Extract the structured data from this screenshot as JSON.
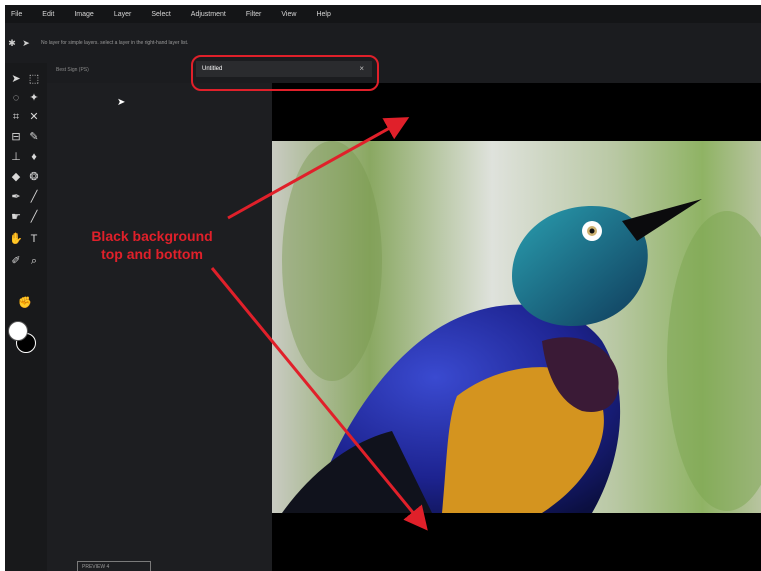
{
  "menu": [
    "File",
    "Edit",
    "Image",
    "Layer",
    "Select",
    "Adjustment",
    "Filter",
    "View",
    "Help"
  ],
  "options_bar": {
    "hint": "No layer for simple layers. select a layer in the right-hand layer list."
  },
  "tabs": {
    "inactive_label": "Best Sign (PS)",
    "active_label": "Untitled",
    "close_glyph": "×"
  },
  "status": {
    "zoom_label": "PREVIEW 4"
  },
  "annotation": {
    "line1": "Black background",
    "line2": "top and bottom"
  },
  "colors": {
    "accent": "#e0202a",
    "workspace": "#1b1c1f",
    "canvas_background": "#000000"
  },
  "icons": {
    "tool_1": "move-icon",
    "tool_2": "marquee-icon",
    "tool_3": "lasso-icon",
    "tool_4": "magic-wand-icon",
    "tool_5": "crop-icon",
    "tool_6": "slice-icon",
    "tool_7": "eyedropper-icon",
    "tool_8": "brush-icon",
    "tool_9": "clone-stamp-icon",
    "tool_10": "fill-icon",
    "tool_11": "eraser-icon",
    "tool_12": "blur-icon",
    "tool_13": "pen-icon",
    "tool_14": "line-icon",
    "tool_15": "smudge-icon",
    "tool_16": "shape-icon",
    "tool_17": "hand-icon",
    "tool_18": "text-icon",
    "tool_19": "color-picker-icon",
    "tool_20": "zoom-icon"
  }
}
